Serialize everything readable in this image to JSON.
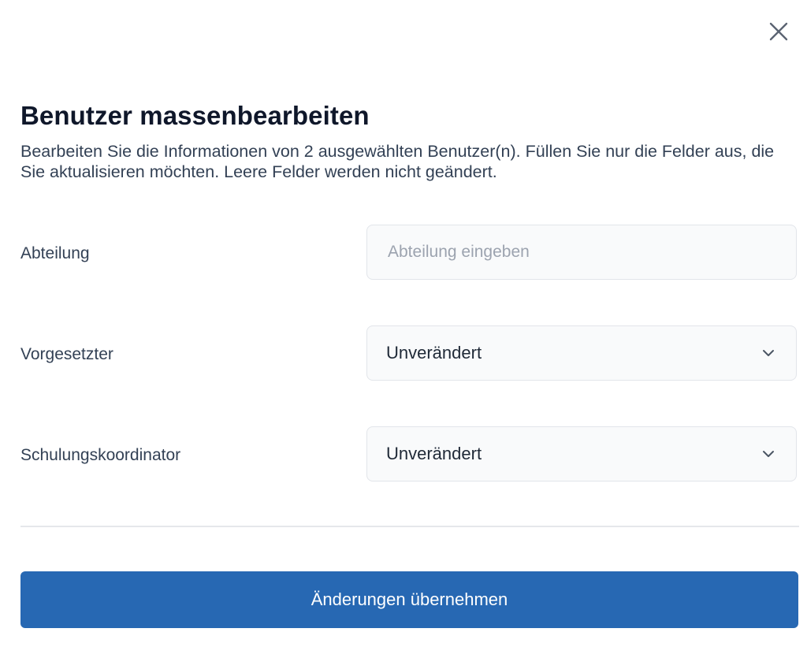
{
  "dialog": {
    "title": "Benutzer massenbearbeiten",
    "description": "Bearbeiten Sie die Informationen von 2 ausgewählten Benutzer(n). Füllen Sie nur die Felder aus, die Sie aktualisieren möchten. Leere Felder werden nicht geändert.",
    "close_icon": "close-icon"
  },
  "fields": {
    "department": {
      "label": "Abteilung",
      "value": "",
      "placeholder": "Abteilung eingeben"
    },
    "supervisor": {
      "label": "Vorgesetzter",
      "selected": "Unverändert",
      "icon": "chevron-down-icon"
    },
    "training_coordinator": {
      "label": "Schulungskoordinator",
      "selected": "Unverändert",
      "icon": "chevron-down-icon"
    }
  },
  "actions": {
    "submit_label": "Änderungen übernehmen"
  },
  "colors": {
    "primary_button": "#2768b3",
    "title_text": "#0f172a",
    "field_border": "#e2e5ea",
    "field_background": "#f9fafb"
  }
}
